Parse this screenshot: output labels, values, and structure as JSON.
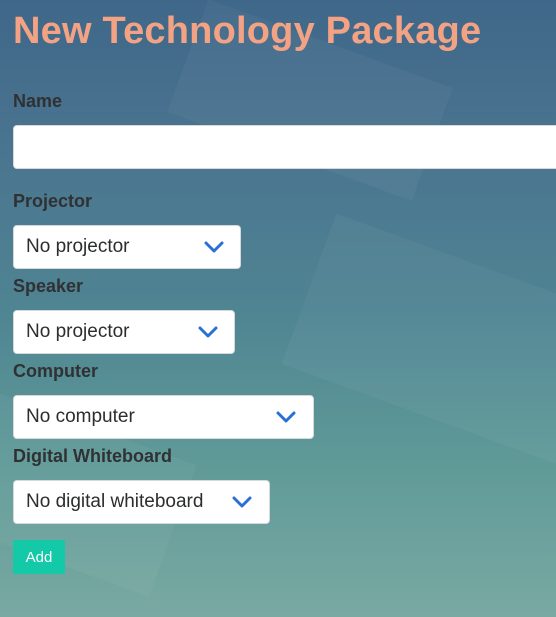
{
  "page": {
    "title": "New Technology Package"
  },
  "form": {
    "name": {
      "label": "Name",
      "value": "",
      "placeholder": ""
    },
    "projector": {
      "label": "Projector",
      "selected": "No projector"
    },
    "speaker": {
      "label": "Speaker",
      "selected": "No projector"
    },
    "computer": {
      "label": "Computer",
      "selected": "No computer"
    },
    "digital_whiteboard": {
      "label": "Digital Whiteboard",
      "selected": "No digital whiteboard"
    },
    "submit_label": "Add"
  },
  "colors": {
    "title": "#f3a283",
    "button": "#14c9a8",
    "chevron": "#2a6fd6"
  },
  "icons": {
    "dropdown": "chevron-down-icon"
  }
}
